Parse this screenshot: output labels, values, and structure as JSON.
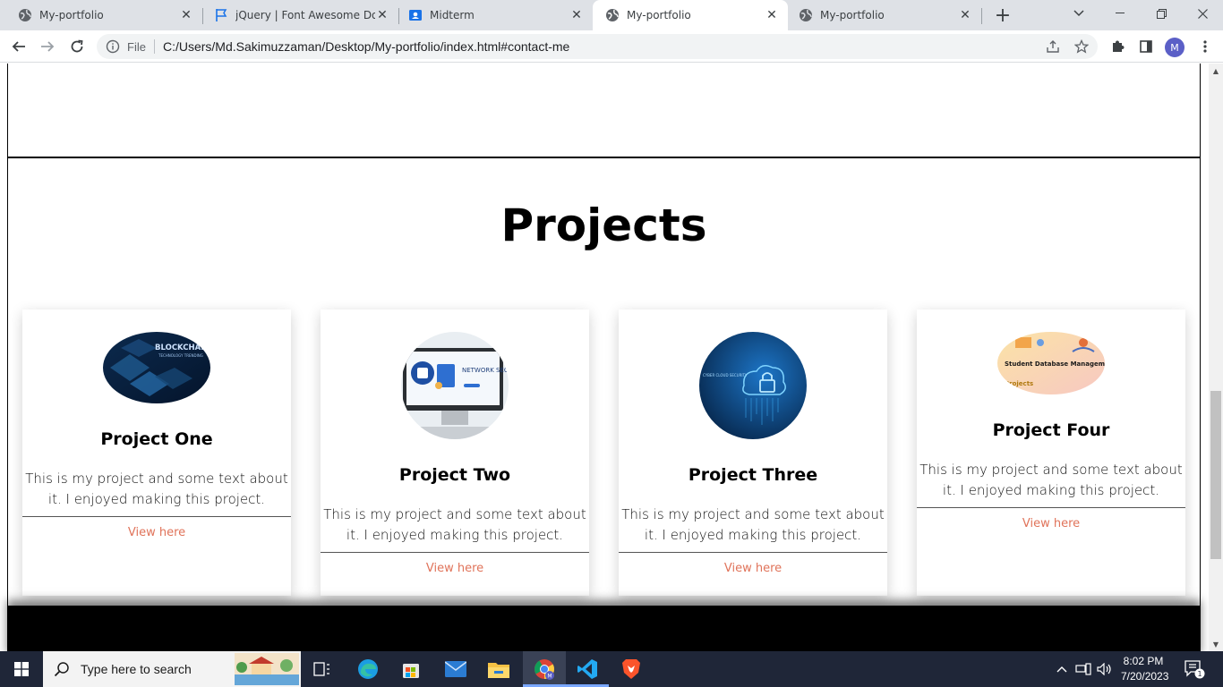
{
  "browser": {
    "tabs": [
      {
        "title": "My-portfolio",
        "favicon": "globe-icon",
        "active": false
      },
      {
        "title": "jQuery | Font Awesome Docs",
        "favicon": "flag-icon",
        "active": false
      },
      {
        "title": "Midterm",
        "favicon": "classroom-icon",
        "active": false
      },
      {
        "title": "My-portfolio",
        "favicon": "globe-icon",
        "active": true
      },
      {
        "title": "My-portfolio",
        "favicon": "globe-icon",
        "active": false
      }
    ],
    "omnibox": {
      "scheme_label": "File",
      "url": "C:/Users/Md.Sakimuzzaman/Desktop/My-portfolio/index.html#contact-me"
    },
    "profile_initial": "M"
  },
  "page": {
    "section_title": "Projects",
    "projects": [
      {
        "title": "Project One",
        "text": "This is my project and some text about it. I enjoyed making this project.",
        "link": "View here",
        "image_text": "BLOCKCHAIN",
        "image_subtext": "TECHNOLOGY TRENDING"
      },
      {
        "title": "Project Two",
        "text": "This is my project and some text about it. I enjoyed making this project.",
        "link": "View here",
        "image_text": "NETWORK SECURITY",
        "image_subtext": ""
      },
      {
        "title": "Project Three",
        "text": "This is my project and some text about it. I enjoyed making this project.",
        "link": "View here",
        "image_text": "CYBER CLOUD SECURITY",
        "image_subtext": ""
      },
      {
        "title": "Project Four",
        "text": "This is my project and some text about it. I enjoyed making this project.",
        "link": "View here",
        "image_text": "Student Database Management System",
        "image_subtext": "Projects"
      }
    ],
    "link_color": "#e0735a"
  },
  "taskbar": {
    "search_placeholder": "Type here to search",
    "time": "8:02 PM",
    "date": "7/20/2023",
    "notification_count": "1"
  }
}
